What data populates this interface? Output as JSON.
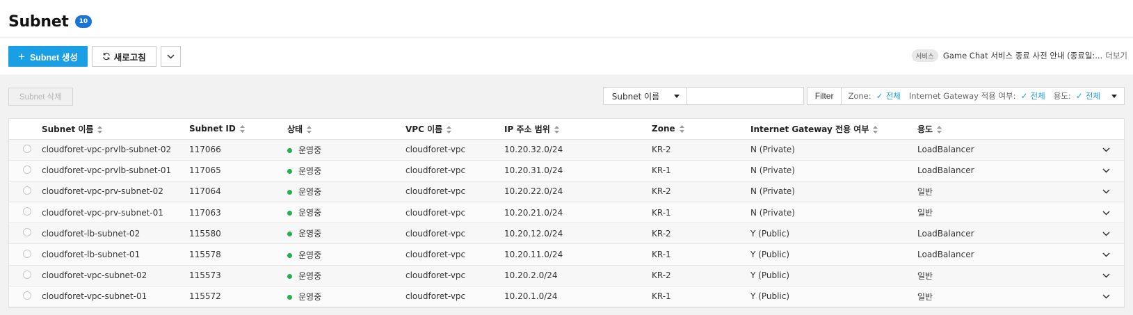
{
  "page": {
    "title": "Subnet",
    "count": "10"
  },
  "toolbar": {
    "create_label": "Subnet 생성",
    "refresh_label": "새로고침"
  },
  "notice": {
    "badge": "서비스",
    "text": "Game Chat 서비스 종료 사전 안내 (종료일:...",
    "more": "더보기"
  },
  "actions": {
    "delete_label": "Subnet 삭제"
  },
  "search": {
    "field_label": "Subnet 이름",
    "placeholder": ""
  },
  "filter": {
    "button_label": "Filter",
    "items": [
      {
        "label": "Zone:",
        "value": "전체"
      },
      {
        "label": "Internet Gateway 적용 여부:",
        "value": "전체"
      },
      {
        "label": "용도:",
        "value": "전체"
      }
    ]
  },
  "table": {
    "columns": [
      "Subnet 이름",
      "Subnet ID",
      "상태",
      "VPC 이름",
      "IP 주소 범위",
      "Zone",
      "Internet Gateway 전용 여부",
      "용도"
    ],
    "rows": [
      {
        "name": "cloudforet-vpc-prvlb-subnet-02",
        "id": "117066",
        "status": "운영중",
        "vpc": "cloudforet-vpc",
        "ip": "10.20.32.0/24",
        "zone": "KR-2",
        "igw": "N (Private)",
        "usage": "LoadBalancer"
      },
      {
        "name": "cloudforet-vpc-prvlb-subnet-01",
        "id": "117065",
        "status": "운영중",
        "vpc": "cloudforet-vpc",
        "ip": "10.20.31.0/24",
        "zone": "KR-1",
        "igw": "N (Private)",
        "usage": "LoadBalancer"
      },
      {
        "name": "cloudforet-vpc-prv-subnet-02",
        "id": "117064",
        "status": "운영중",
        "vpc": "cloudforet-vpc",
        "ip": "10.20.22.0/24",
        "zone": "KR-2",
        "igw": "N (Private)",
        "usage": "일반"
      },
      {
        "name": "cloudforet-vpc-prv-subnet-01",
        "id": "117063",
        "status": "운영중",
        "vpc": "cloudforet-vpc",
        "ip": "10.20.21.0/24",
        "zone": "KR-1",
        "igw": "N (Private)",
        "usage": "일반"
      },
      {
        "name": "cloudforet-lb-subnet-02",
        "id": "115580",
        "status": "운영중",
        "vpc": "cloudforet-vpc",
        "ip": "10.20.12.0/24",
        "zone": "KR-2",
        "igw": "Y (Public)",
        "usage": "LoadBalancer"
      },
      {
        "name": "cloudforet-lb-subnet-01",
        "id": "115578",
        "status": "운영중",
        "vpc": "cloudforet-vpc",
        "ip": "10.20.11.0/24",
        "zone": "KR-1",
        "igw": "Y (Public)",
        "usage": "LoadBalancer"
      },
      {
        "name": "cloudforet-vpc-subnet-02",
        "id": "115573",
        "status": "운영중",
        "vpc": "cloudforet-vpc",
        "ip": "10.20.2.0/24",
        "zone": "KR-2",
        "igw": "Y (Public)",
        "usage": "일반"
      },
      {
        "name": "cloudforet-vpc-subnet-01",
        "id": "115572",
        "status": "운영중",
        "vpc": "cloudforet-vpc",
        "ip": "10.20.1.0/24",
        "zone": "KR-1",
        "igw": "Y (Public)",
        "usage": "일반"
      }
    ]
  },
  "colors": {
    "primary": "#1a9fe5",
    "badge": "#1a73d6",
    "status_running": "#22b14c"
  }
}
